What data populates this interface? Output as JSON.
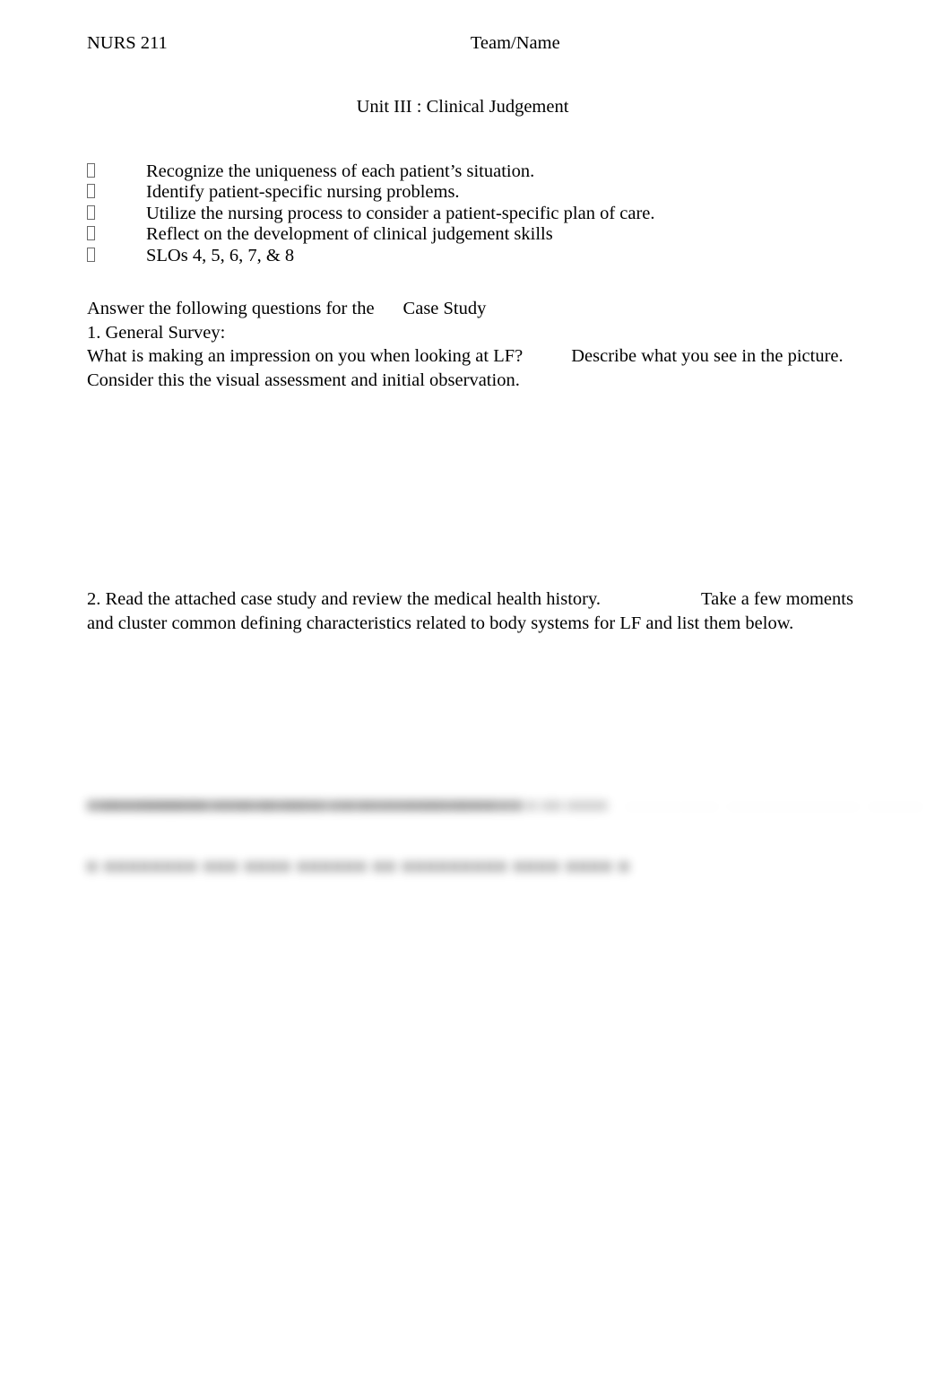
{
  "header": {
    "course_code": "NURS 211",
    "team_name_label": "Team/Name"
  },
  "title": "Unit III : Clinical Judgement",
  "objectives": {
    "bullet_glyph": "missing-glyph-box",
    "items": [
      "Recognize the uniqueness of each patient’s situation.",
      "Identify patient-specific nursing problems.",
      "Utilize the nursing process to consider a patient-specific plan of care.",
      "Reflect on the development of clinical judgement skills",
      "SLOs 4, 5, 6, 7, & 8"
    ]
  },
  "body": {
    "answer_intro": "Answer the following questions for the",
    "answer_intro_tail": "Case Study",
    "question1_heading": "1. General Survey:",
    "question1_line1a": "What is making an impression on you when looking at LF?",
    "question1_line1b": "Describe what you see in the picture.",
    "question1_line2": "Consider this the visual assessment and initial observation.",
    "question2_line1a": "2. Read the attached case study and review the medical health history.",
    "question2_line1b": "Take a few moments",
    "question2_line2": "and cluster common defining characteristics related to body systems for LF and list them below."
  },
  "redacted": {
    "description": "blurred illegible text block",
    "lines": [
      "——————  ———————  ————",
      "————  ———  ——",
      "—————  ———————  ———",
      "■  ■■■■■■■■  ■■■  ■■■■  ■■■■■■  ■■  ■■■■■■■■■  ■■■■  ■■■■  ■",
      "■■■  ■■■  ■■  ■■■■■■■  ■■■■",
      "■  ■■■  ■■■■■■■  ■■■■  ■■  ■■■■  ■■■■  ■■  ■■■■■■■■  ■",
      "■■   ■■■  ■■■■■",
      "■■   ■■  ■■  ■■■■",
      "■■■  ■■■■■■  ■■  ■■■■■■  ■■■■  —  ■■■  ■■  ■■■■■■■■■■  ■  ■  ■■  ■■■■",
      "■■■■■  ■■■■  ■■■■■■  ■■  ■■■  ■■■■  ■■  ■■■  ■■■  ■■■■  ■■",
      "■   ■■■■■■■■  ■■  ■■  ■■  ■■  ■■■■  ■■  ■■■  ■■■■■  ■■  ■■■■■"
    ]
  }
}
